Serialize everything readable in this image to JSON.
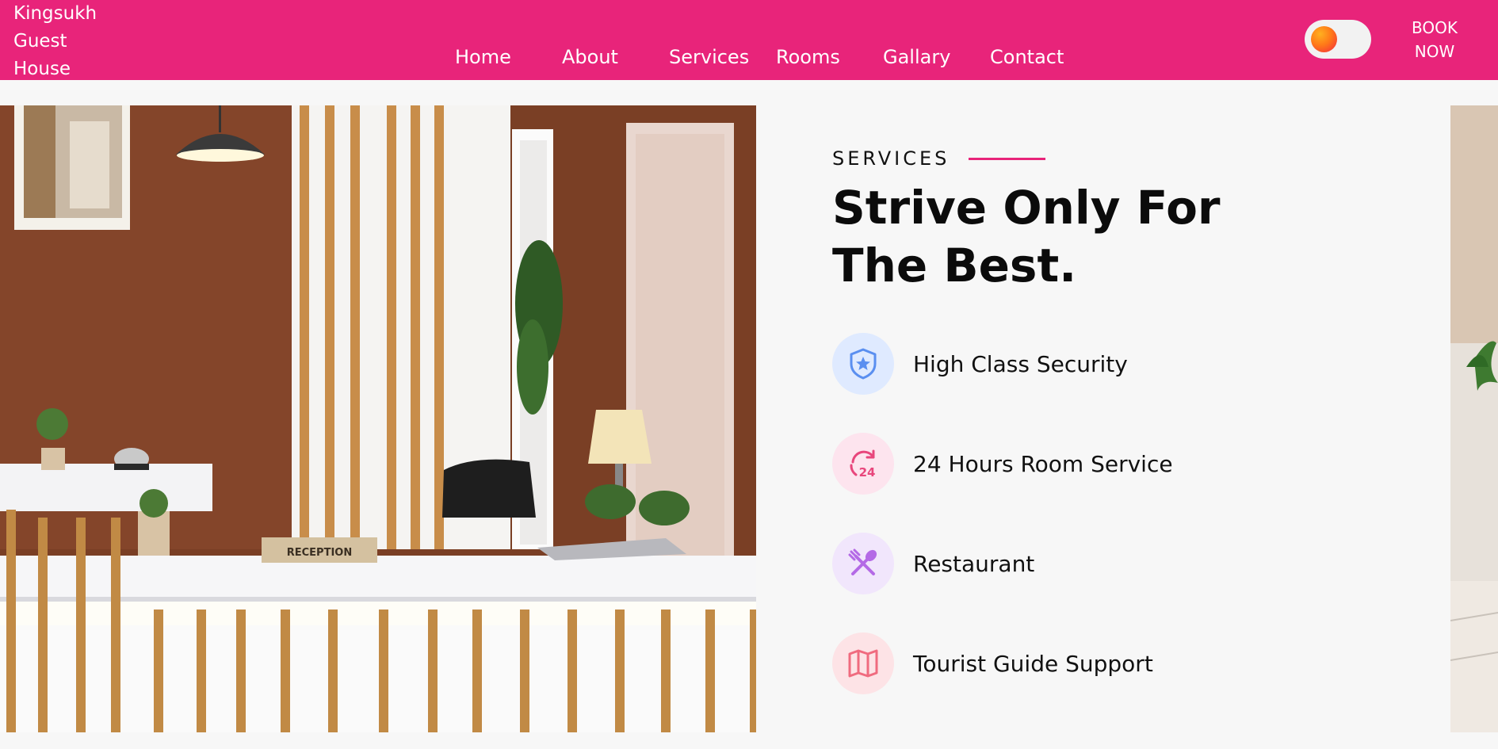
{
  "navbar": {
    "brand": "Kingsukh Guest House",
    "links": [
      {
        "label": "Home"
      },
      {
        "label": "About"
      },
      {
        "label": "Services"
      },
      {
        "label": "Rooms"
      },
      {
        "label": "Gallary"
      },
      {
        "label": "Contact"
      }
    ],
    "cta": "BOOK NOW"
  },
  "hero": {
    "sign_text": "RECEPTION"
  },
  "services": {
    "eyebrow": "SERVICES",
    "headline": "Strive Only For The Best.",
    "items": [
      {
        "label": "High Class Security",
        "icon": "shield-star-icon",
        "color": "#5a8ff0",
        "bg": "#dfeaff"
      },
      {
        "label": "24 Hours Room Service",
        "icon": "24-hours-icon",
        "color": "#e8467c",
        "bg": "#fde4ee"
      },
      {
        "label": "Restaurant",
        "icon": "utensils-icon",
        "color": "#b46ae6",
        "bg": "#f1e6fc"
      },
      {
        "label": "Tourist Guide Support",
        "icon": "map-icon",
        "color": "#f06b7f",
        "bg": "#fde3e6"
      }
    ]
  },
  "colors": {
    "brand": "#e8247a",
    "page_bg": "#f7f7f7"
  }
}
